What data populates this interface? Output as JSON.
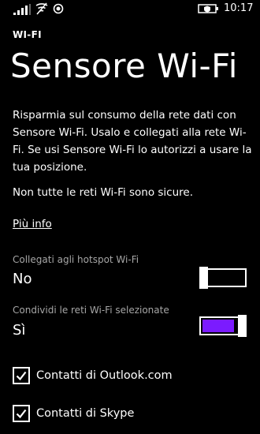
{
  "status_bar": {
    "time": "10:17",
    "icons": [
      "signal-strength-icon",
      "wifi-icon",
      "location-icon",
      "battery-saver-icon"
    ]
  },
  "app_title": "WI-FI",
  "page_title": "Sensore Wi-Fi",
  "description": "Risparmia sul consumo della rete dati con Sensore Wi-Fi. Usalo e collegati alla rete Wi-Fi. Se usi Sensore Wi-Fi lo autorizzi a usare la tua posizione.",
  "warning": "Non tutte le reti Wi-Fi sono sicure.",
  "more_info_link": "Più info",
  "settings": {
    "hotspot": {
      "label": "Collegati agli hotspot Wi-Fi",
      "state": "No",
      "on": false
    },
    "share": {
      "label": "Condividi le reti Wi-Fi selezionate",
      "state": "Sì",
      "on": true
    }
  },
  "checkboxes": [
    {
      "label": "Contatti di Outlook.com",
      "checked": true
    },
    {
      "label": "Contatti di Skype",
      "checked": true
    }
  ],
  "colors": {
    "background": "#000000",
    "accent": "#7b1bff",
    "secondary_text": "#a6a6a6"
  }
}
